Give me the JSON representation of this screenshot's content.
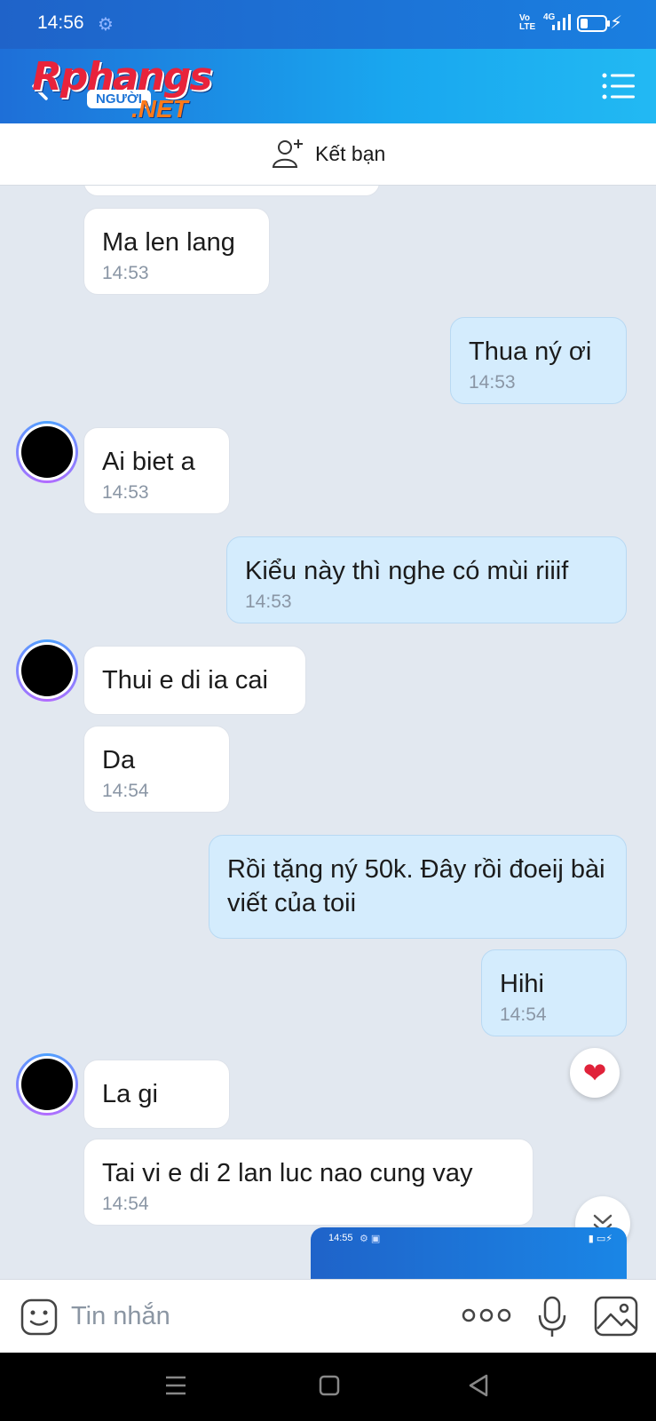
{
  "status_bar": {
    "time": "14:56",
    "settings_icon": "gear-icon",
    "volte": "Vo LTE",
    "network": "4G",
    "battery_icon": "battery-charging-icon"
  },
  "header": {
    "logo_brand": "Rphangs",
    "logo_tag": "NGƯỜI",
    "logo_suffix": ".NET",
    "back_icon": "back-arrow-icon",
    "menu_icon": "list-menu-icon"
  },
  "add_friend": {
    "label": "Kết bạn",
    "icon": "add-friend-icon"
  },
  "messages": [
    {
      "side": "in",
      "text": "Ma len lang",
      "time": "14:53"
    },
    {
      "side": "out",
      "text": "Thua ný ơi",
      "time": "14:53"
    },
    {
      "side": "in",
      "text": "Ai biet a",
      "time": "14:53"
    },
    {
      "side": "out",
      "text": "Kiểu này thì nghe có mùi riiif",
      "time": "14:53"
    },
    {
      "side": "in",
      "text": "Thui e di ia cai",
      "time": ""
    },
    {
      "side": "in",
      "text": "Da",
      "time": "14:54"
    },
    {
      "side": "out",
      "text": "Rồi tặng ný 50k. Đây rồi đoeij bài viết của toii",
      "time": ""
    },
    {
      "side": "out",
      "text": "Hihi",
      "time": "14:54"
    },
    {
      "side": "in",
      "text": "La gi",
      "time": ""
    },
    {
      "side": "in",
      "text": "Tai vi e di 2 lan luc nao cung vay",
      "time": "14:54"
    }
  ],
  "reaction": {
    "icon": "heart-icon"
  },
  "image_preview": {
    "time": "14:55"
  },
  "composer": {
    "placeholder": "Tin nhắn",
    "emoji_icon": "emoji-icon",
    "more_icon": "more-dots-icon",
    "mic_icon": "microphone-icon",
    "image_icon": "image-icon"
  },
  "colors": {
    "header_start": "#1e6fd8",
    "header_end": "#22b9f3",
    "chat_bg": "#e2e8f0",
    "out_bubble": "#d4ecfd",
    "in_bubble": "#ffffff"
  }
}
